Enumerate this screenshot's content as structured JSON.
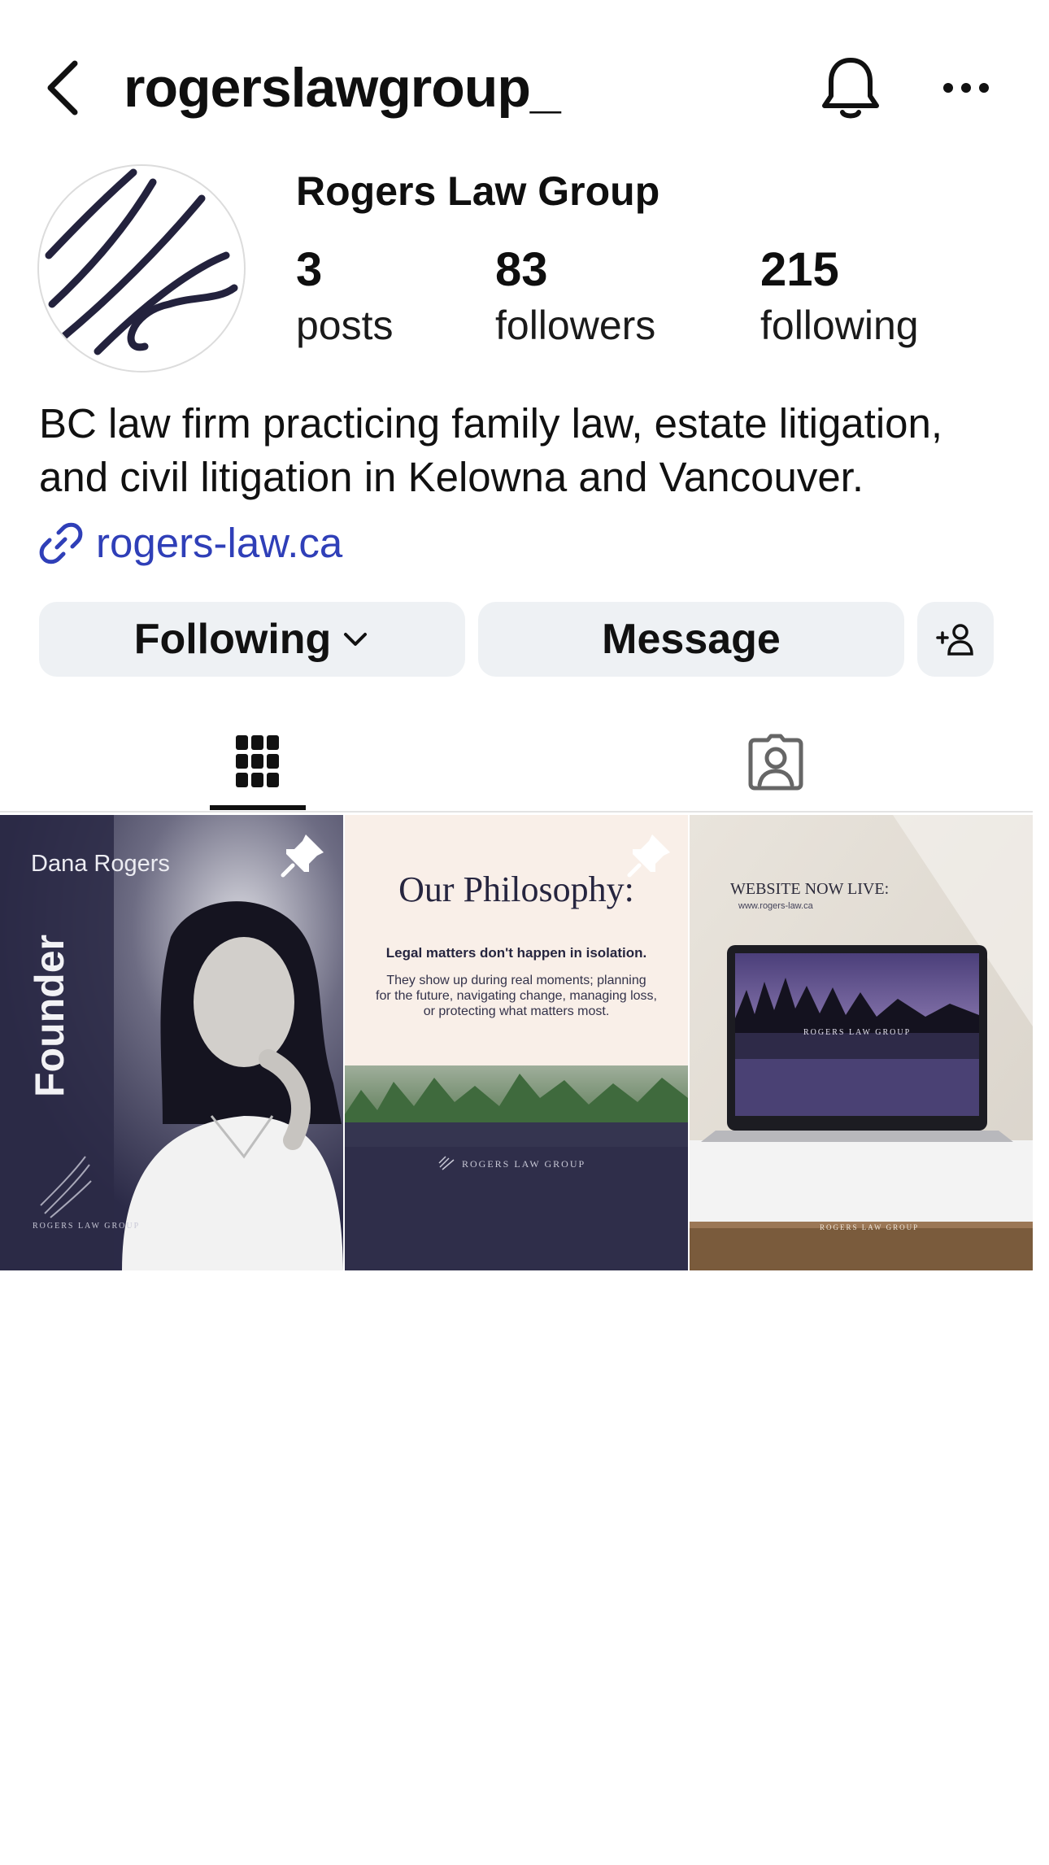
{
  "header": {
    "username": "rogerslawgroup_",
    "icons": [
      "chevron-left-icon",
      "bell-icon",
      "more-icon"
    ]
  },
  "profile": {
    "display_name": "Rogers Law Group",
    "stats": {
      "posts_count": "3",
      "posts_label": "posts",
      "followers_count": "83",
      "followers_label": "followers",
      "following_count": "215",
      "following_label": "following"
    },
    "bio_line1": "BC law firm practicing family law, estate litigation,",
    "bio_line2": "and civil litigation in Kelowna and Vancouver.",
    "link": "rogers-law.ca"
  },
  "actions": {
    "following_label": "Following",
    "message_label": "Message"
  },
  "tabs": [
    "grid-icon",
    "tagged-icon"
  ],
  "posts": [
    {
      "name_text": "Dana Rogers",
      "vertical_text": "Founder",
      "brand_text": "ROGERS LAW GROUP",
      "pinned": true
    },
    {
      "heading": "Our Philosophy:",
      "subheading": "Legal matters don't happen in isolation.",
      "body_line1": "They show up during real moments; planning",
      "body_line2": "for the future, navigating change, managing loss,",
      "body_line3": "or protecting what matters most.",
      "brand_text": "ROGERS LAW GROUP",
      "pinned": true
    },
    {
      "heading": "WEBSITE NOW LIVE:",
      "url_text": "www.rogers-law.ca",
      "screen_brand": "ROGERS LAW GROUP",
      "brand_text": "ROGERS LAW GROUP"
    }
  ],
  "colors": {
    "link": "#2f3fb8",
    "button_bg": "#eef1f4",
    "post_navy": "#2b2a47"
  }
}
